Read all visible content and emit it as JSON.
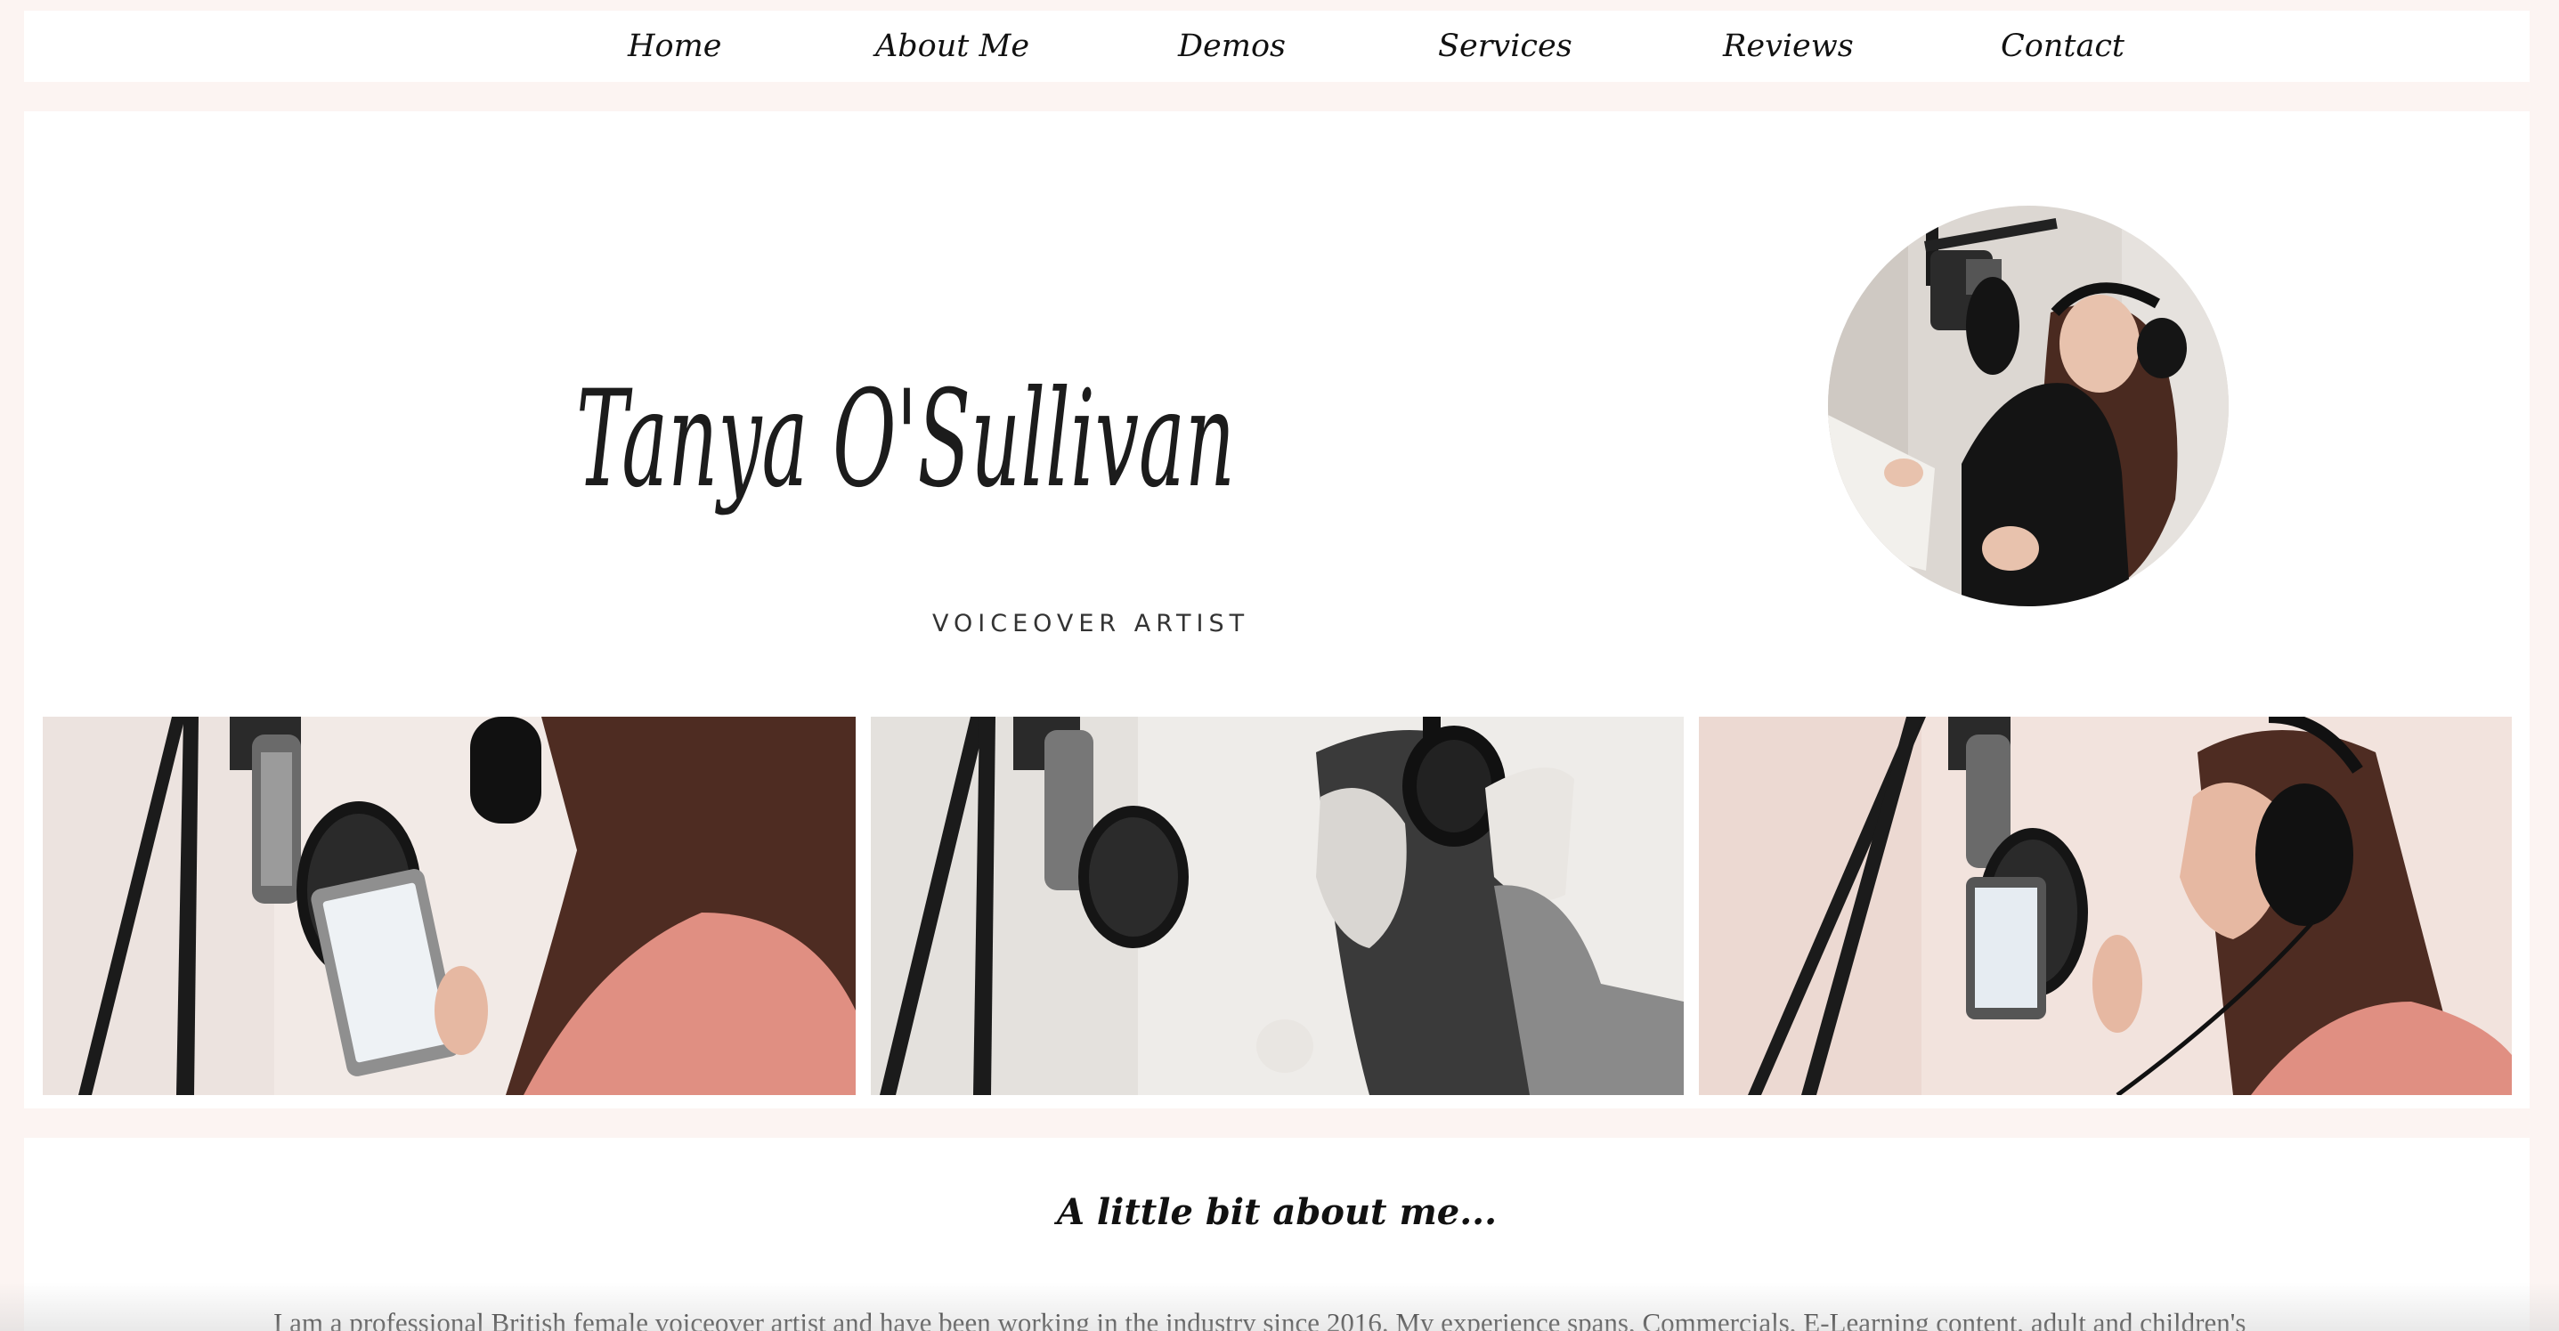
{
  "nav": {
    "items": [
      {
        "label": "Home"
      },
      {
        "label": "About Me"
      },
      {
        "label": "Demos"
      },
      {
        "label": "Services"
      },
      {
        "label": "Reviews"
      },
      {
        "label": "Contact"
      }
    ]
  },
  "hero": {
    "name": "Tanya O'Sullivan",
    "tagline": "VOICEOVER ARTIST",
    "portrait_icon": "voiceover-artist-portrait",
    "gallery": [
      {
        "icon": "studio-photo-tablet"
      },
      {
        "icon": "studio-photo-headphones"
      },
      {
        "icon": "studio-photo-singing"
      }
    ]
  },
  "about": {
    "heading": "A little bit about me...",
    "text": "I am a professional British female voiceover artist and have been working in the industry since 2016. My experience spans, Commercials, E-Learning content, adult and children's"
  },
  "colors": {
    "page_background": "#fcf4f2",
    "panel_background": "#ffffff",
    "text": "#111111",
    "sweater_pink": "#e08f82"
  }
}
